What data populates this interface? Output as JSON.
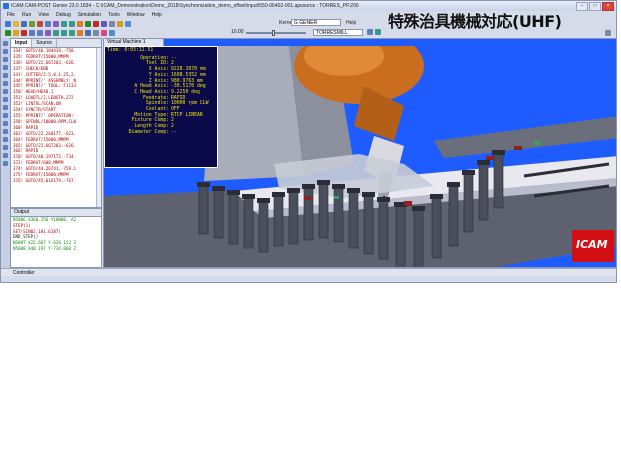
{
  "window": {
    "title": "ICAM CAM-POST Genier 23.0 1834 - C:\\ICAM_Demonstration\\Demo_2018\\Synchronization_demo_offset\\input\\550-06402-001.apsource : TORRES_PP.200",
    "controls": [
      "–",
      "□",
      "×"
    ]
  },
  "menu": [
    "File",
    "Run",
    "View",
    "Debug",
    "Simulation",
    "Tools",
    "Window",
    "Help"
  ],
  "toolbar": {
    "kernel_label": "Kernel",
    "kernel_value": "G GENER",
    "help_label": "Help",
    "speed_value": "10.00",
    "machine_value": "TORRESMILL"
  },
  "banner": "特殊治具機械対応(UHF)",
  "colors": {
    "accent": "#1f5cff",
    "logo": "#d20f12",
    "code": "#b00000",
    "readout_text": "#f2e300"
  },
  "input_panel": {
    "tabs": [
      "Input",
      "Source"
    ],
    "lines": [
      "334! GOTO/46.104419,-758.",
      "335! FEDRAT/15000,MMPM",
      "336! GOTO/22.667203,-626.",
      "337! CHECK/END",
      "341! CUTTER/2.5,0,1.25,2.",
      "344! PPRINT/' ASSEMBLY: N",
      "345! PPRINT/' TOOL: F1133",
      "350! HEAD/HEAD,1",
      "351! LOADTL/2,LENGTH,272",
      "352! LINTOL/SCAN,ON",
      "354! SYNCTR/START",
      "355! PPRINT/' OPERATION:",
      "358! SPINDL/10000,RPM,CLW",
      "360! RAPID",
      "361! GOTO/22.260177,-623.",
      "364! FEDRAT/15000,MMPM",
      "365! GOTO/22.667203,-626.",
      "366! RAPID",
      "370! GOTO/40.197172,-734.",
      "372! FEDRAT/600,MMPM",
      "374! GOTO/44.26741,-759.1",
      "375! FEDRAT/15000,MMPM",
      "376! GOTO/45.616179,-767."
    ]
  },
  "output_panel": {
    "title": "Output",
    "lines": [
      {
        "text": "N5006 X360.256 Y10000. A2",
        "style": "g"
      },
      {
        "text": "STEP(1)",
        "style": "r"
      },
      {
        "text": "SET(SIN02,101.6187)",
        "style": "r"
      },
      {
        "text": "END_STEP()",
        "style": ""
      },
      {
        "text": "N5007 X22.667 Y-626.152 Z",
        "style": "g"
      },
      {
        "text": "N5008 X40.197 Y-734.088 Z",
        "style": "g"
      }
    ]
  },
  "vm": {
    "tab_label": "Virtual Machine 1",
    "time_label": "Time:",
    "time_value": "0:03:12.51",
    "readout": [
      {
        "k": "Operation:",
        "v": "--"
      },
      {
        "k": "Tool ID:",
        "v": "2"
      },
      {
        "k": "X Axis:",
        "v": "9228.1070 mm"
      },
      {
        "k": "Y Axis:",
        "v": "1698.5352 mm"
      },
      {
        "k": "Z Axis:",
        "v": "980.9763 mm"
      },
      {
        "k": "A Head Axis:",
        "v": "-30.5170 deg"
      },
      {
        "k": "C Head Axis:",
        "v": "9.2250 deg"
      },
      {
        "k": "Feedrate:",
        "v": "RAPID"
      },
      {
        "k": "Spindle:",
        "v": "10000 rpm CLW"
      },
      {
        "k": "Coolant:",
        "v": "OFF"
      },
      {
        "k": "Motion Type:",
        "v": "RTCP LINEAR"
      },
      {
        "k": "Fixture Comp:",
        "v": "2"
      },
      {
        "k": "Length Comp:",
        "v": "2"
      },
      {
        "k": "Diameter Comp:",
        "v": "--"
      }
    ],
    "logo_text": "ICAM"
  },
  "bottom_bar": {
    "label": "Controller"
  }
}
